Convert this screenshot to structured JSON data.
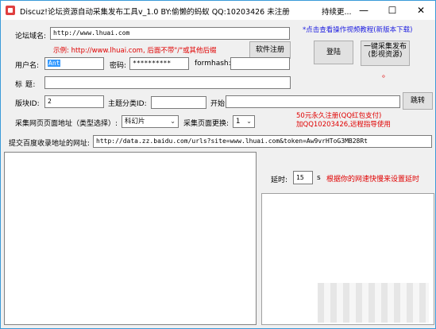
{
  "window": {
    "title": "Discuz!论坛资源自动采集发布工具v_1.0     BY:偷懒的蚂蚁   QQ:10203426        未注册",
    "title_extra": "持续更..."
  },
  "form": {
    "forum_domain_label": "论坛域名:",
    "forum_domain_value": "http://www.lhuai.com",
    "example_text": "示例: http://www.lhuai.com, 后面不带\"/\"或其他后缀",
    "register_button": "软件注册",
    "tutorial_link": "*点击查看操作视频教程(新版本下载)",
    "username_label": "用户名:",
    "username_value": "Ant",
    "password_label": "密码:",
    "password_value": "**********",
    "formhash_label": "formhash:",
    "formhash_value": "",
    "login_button": "登陆",
    "publish_button": "一键采集发布(影视资源)",
    "publish_dot": "。",
    "title_label": "标  题:",
    "title_value": "",
    "board_id_label": "版块ID:",
    "board_id_value": "2",
    "topic_cat_label": "主题分类ID:",
    "topic_cat_value": "",
    "start_label": "开始:",
    "start_value": "",
    "jump_button": "跳转",
    "collect_type_label": "采集网页页面地址（类型选择）:",
    "collect_type_value": "科幻片",
    "page_change_label": "采集页面更换:",
    "page_change_value": "1",
    "promo_line1": "50元永久注册(QQ红包支付)",
    "promo_line2": "加QQ10203426,远程指导使用",
    "baidu_label": "提交百度收录地址的网址:",
    "baidu_value": "http://data.zz.baidu.com/urls?site=www.lhuai.com&token=Aw9vrHToG3MB28Rt",
    "delay_label": "延时:",
    "delay_value": "15",
    "delay_unit": "s",
    "delay_hint": "根据你的网速快慢来设置延时"
  },
  "colors": {
    "accent_red": "#e00000",
    "link_blue": "#2020e0",
    "window_border": "#3a9ad9"
  }
}
